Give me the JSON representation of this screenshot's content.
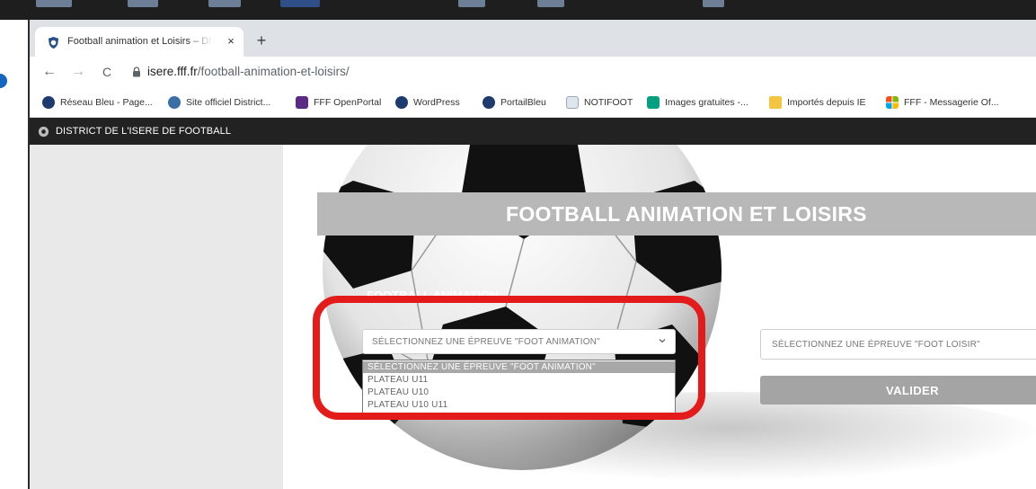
{
  "browser": {
    "tab": {
      "title": "Football animation et Loisirs – DI",
      "close_icon": "×"
    },
    "new_tab_icon": "+",
    "nav": {
      "back_icon": "←",
      "forward_icon": "→",
      "reload_icon": "C"
    },
    "url": {
      "host": "isere.fff.fr",
      "path": "/football-animation-et-loisirs/"
    }
  },
  "bookmarks": [
    {
      "label": "Réseau Bleu - Page...",
      "icon": "fff-crest-icon",
      "color": "#1d3b6f"
    },
    {
      "label": "Site officiel District...",
      "icon": "district-crest-icon",
      "color": "#3a6ea5"
    },
    {
      "label": "FFF OpenPortal",
      "icon": "openportal-icon",
      "color": "#5b2a86"
    },
    {
      "label": "WordPress",
      "icon": "fff-crest-icon",
      "color": "#1d3b6f"
    },
    {
      "label": "PortailBleu",
      "icon": "fff-crest-icon",
      "color": "#1d3b6f"
    },
    {
      "label": "NOTIFOOT",
      "icon": "doc-icon",
      "color": "#9aa7b5"
    },
    {
      "label": "Images gratuites -...",
      "icon": "pexels-icon",
      "color": "#05a081"
    },
    {
      "label": "Importés depuis IE",
      "icon": "folder-icon",
      "color": "#f4c542"
    },
    {
      "label": "FFF - Messagerie Of...",
      "icon": "windows-icon",
      "color": "#f25022"
    }
  ],
  "site": {
    "header_name": "DISTRICT DE L'ISERE DE FOOTBALL",
    "page_title": "FOOTBALL ANIMATION ET LOISIRS",
    "section_label": "FOOTBALL ANIMATION",
    "animation_select": {
      "value": "SÉLECTIONNEZ UNE ÉPREUVE \"FOOT ANIMATION\"",
      "options": [
        "SÉLECTIONNEZ UNE ÉPREUVE \"FOOT ANIMATION\"",
        "PLATEAU U11",
        "PLATEAU U10",
        "PLATEAU U10 U11"
      ],
      "selected_index": 0
    },
    "loisir_select": {
      "value": "SÉLECTIONNEZ UNE ÉPREUVE \"FOOT LOISIR\""
    },
    "valider_label": "VALIDER"
  },
  "colors": {
    "annotation": "#e41b1b",
    "header_bg": "#222222",
    "title_band": "#b8b8b8",
    "button_bg": "#a4a4a4",
    "tabstrip": "#dee1e6"
  }
}
